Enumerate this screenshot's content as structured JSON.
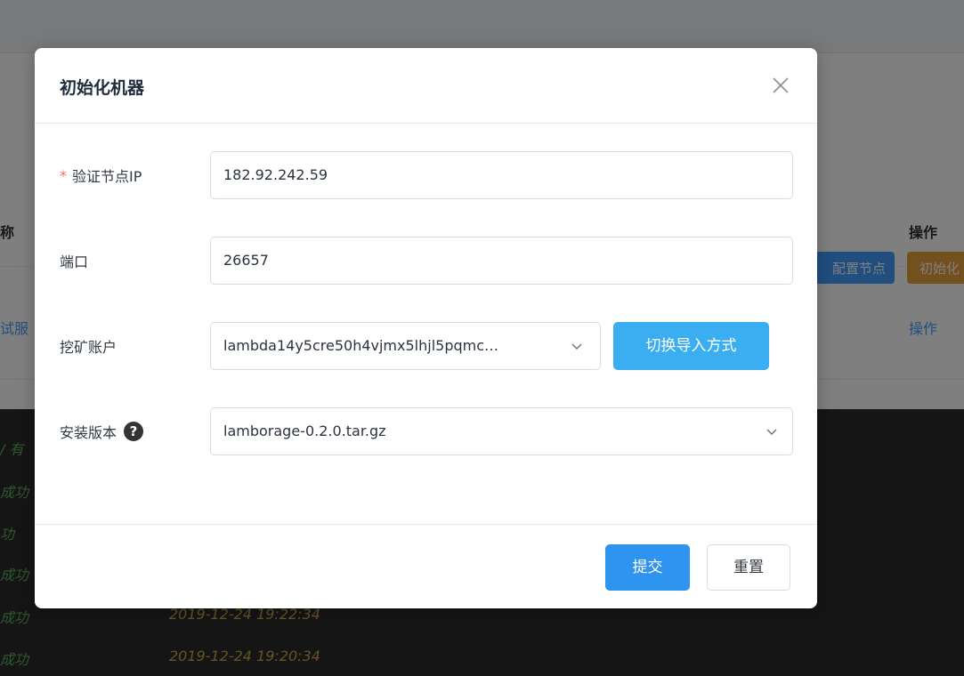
{
  "background": {
    "table": {
      "col_name_fragment": "称",
      "col_actions": "操作",
      "row_name_fragment": "试服",
      "btn_config_node": "配置节点",
      "btn_init": "初始化",
      "row_action": "操作"
    },
    "log": {
      "lines": [
        {
          "status": "/ 有",
          "time": ""
        },
        {
          "status": "成功",
          "time": ""
        },
        {
          "status": "功",
          "time": ""
        },
        {
          "status": "成功",
          "time": ""
        },
        {
          "status": "成功",
          "time": "2019-12-24 19:22:34"
        },
        {
          "status": "成功",
          "time": "2019-12-24 19:20:34"
        }
      ]
    }
  },
  "dialog": {
    "title": "初始化机器",
    "fields": {
      "verify_node_ip": {
        "label": "验证节点IP",
        "required_mark": "*",
        "value": "182.92.242.59"
      },
      "port": {
        "label": "端口",
        "value": "26657"
      },
      "mining_account": {
        "label": "挖矿账户",
        "value": "lambda14y5cre50h4vjmx5lhjl5pqmc…",
        "switch_label": "切换导入方式"
      },
      "install_version": {
        "label": "安装版本",
        "help_symbol": "?",
        "value": "lamborage-0.2.0.tar.gz"
      }
    },
    "footer": {
      "submit_label": "提交",
      "reset_label": "重置"
    }
  },
  "colors": {
    "primary": "#2f93f0",
    "switch_button": "#3aaef0",
    "required": "#f56c6c",
    "log_status": "#5dae5d",
    "log_time": "#c8a84b"
  },
  "icons": [
    "close-icon",
    "chevron-down-icon",
    "help-icon"
  ]
}
